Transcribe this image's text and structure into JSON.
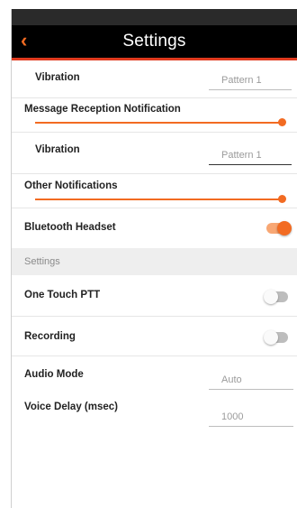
{
  "header": {
    "title": "Settings",
    "back_icon": "chevron-left-icon"
  },
  "colors": {
    "accent": "#f26b22",
    "appbar": "#000000",
    "divider": "#e03a1e"
  },
  "rows": {
    "vibration_1": {
      "label": "Vibration",
      "value": "Pattern 1"
    },
    "message_reception": {
      "label": "Message Reception Notification",
      "level": 1.0
    },
    "vibration_2": {
      "label": "Vibration",
      "value": "Pattern 1"
    },
    "other_notifications": {
      "label": "Other Notifications",
      "level": 1.0
    },
    "bluetooth_headset": {
      "label": "Bluetooth Headset",
      "state": "on"
    }
  },
  "section": {
    "label": "Settings"
  },
  "settings": {
    "one_touch_ptt": {
      "label": "One Touch PTT",
      "state": "off"
    },
    "recording": {
      "label": "Recording",
      "state": "off"
    },
    "audio_mode": {
      "label": "Audio Mode",
      "value": "Auto"
    },
    "voice_delay": {
      "label": "Voice Delay (msec)",
      "value": "1000"
    }
  }
}
